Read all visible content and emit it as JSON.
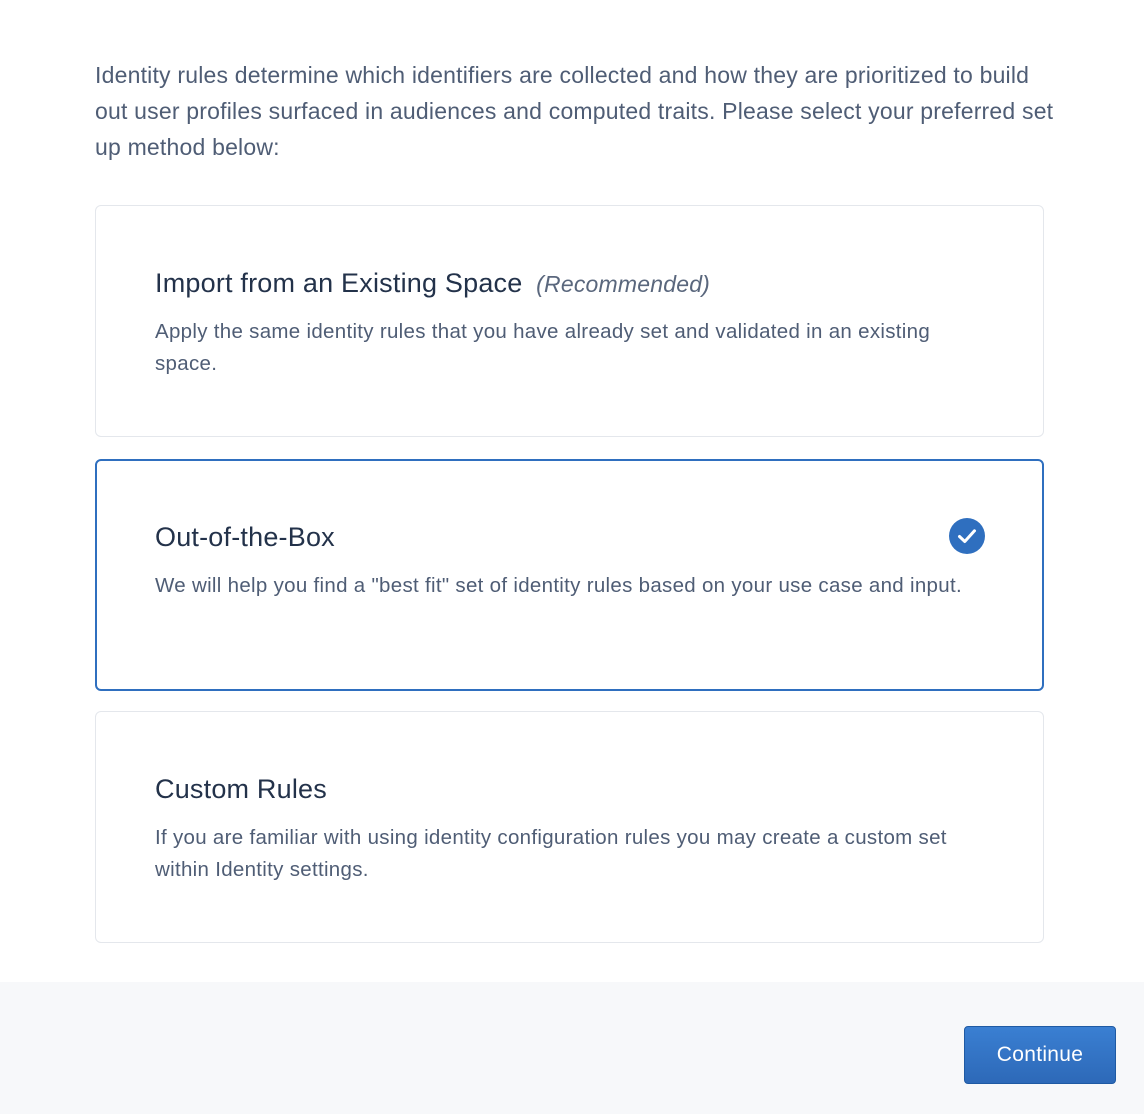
{
  "intro": "Identity rules determine which identifiers are collected and how they are prioritized to build out user profiles surfaced in audiences and computed traits. Please select your preferred set up method below:",
  "options": [
    {
      "title": "Import from an Existing Space",
      "tag": "(Recommended)",
      "description": "Apply the same identity rules that you have already set and validated in an existing space.",
      "selected": false
    },
    {
      "title": "Out-of-the-Box",
      "tag": "",
      "description": "We will help you find a \"best fit\" set of identity rules based on your use case and input.",
      "selected": true
    },
    {
      "title": "Custom Rules",
      "tag": "",
      "description": "If you are familiar with using identity configuration rules you may create a custom set within Identity settings.",
      "selected": false
    }
  ],
  "selected_icon": "checkmark-circle-icon",
  "footer": {
    "continue_label": "Continue"
  },
  "colors": {
    "accent": "#2f6fbf",
    "title_text": "#23324a",
    "body_text": "#4f5d75",
    "footer_bg": "#f7f8fa"
  }
}
